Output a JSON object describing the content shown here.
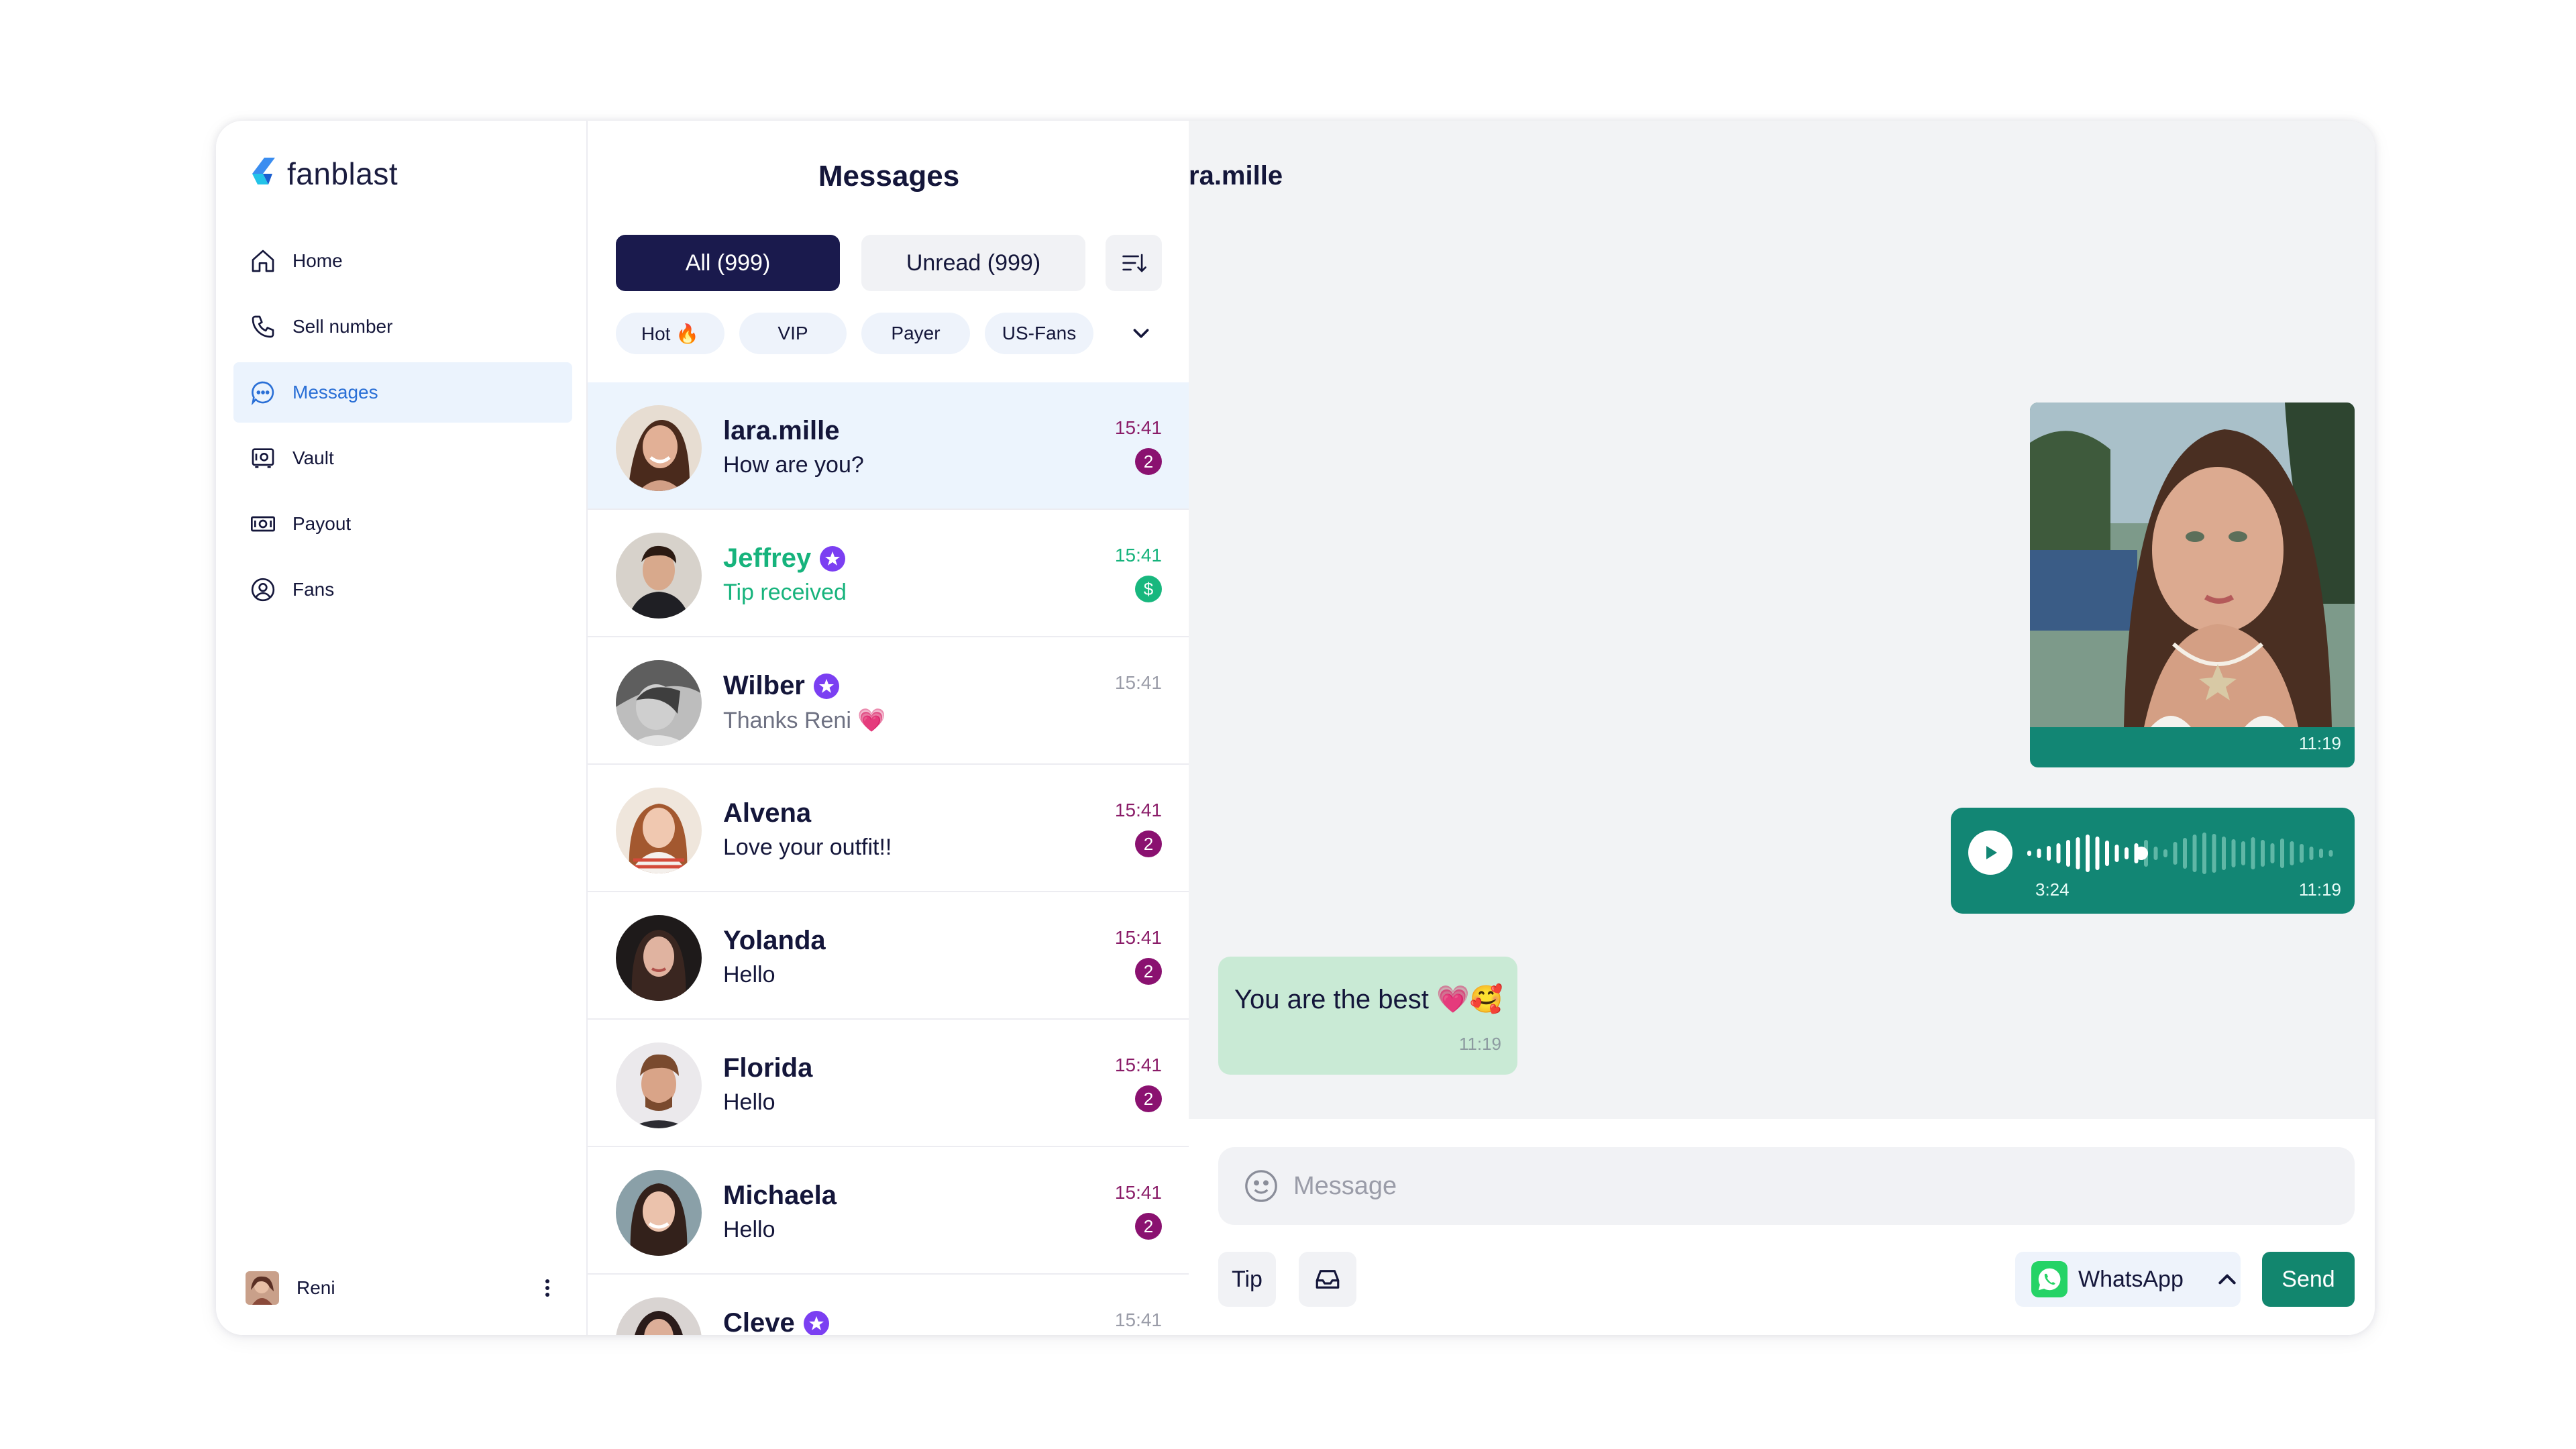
{
  "brand": {
    "name": "fanblast",
    "accent": "#2a6fd6"
  },
  "sidebar": {
    "items": [
      {
        "label": "Home",
        "icon": "home-icon"
      },
      {
        "label": "Sell number",
        "icon": "phone-icon"
      },
      {
        "label": "Messages",
        "icon": "chat-icon",
        "active": true
      },
      {
        "label": "Vault",
        "icon": "vault-icon"
      },
      {
        "label": "Payout",
        "icon": "cash-icon"
      },
      {
        "label": "Fans",
        "icon": "user-circle-icon"
      }
    ],
    "user": {
      "name": "Reni"
    }
  },
  "list": {
    "title": "Messages",
    "filters": {
      "all": "All (999)",
      "unread": "Unread (999)"
    },
    "chips": [
      "Hot 🔥",
      "VIP",
      "Payer",
      "US-Fans"
    ],
    "conversations": [
      {
        "name": "lara.mille",
        "message": "How are you?",
        "time": "15:41",
        "badge": "2"
      },
      {
        "name": "Jeffrey",
        "message": "Tip received",
        "time": "15:41",
        "badge": "$",
        "vip": true
      },
      {
        "name": "Wilber",
        "message": "Thanks Reni 💗",
        "time": "15:41",
        "vip": true
      },
      {
        "name": "Alvena",
        "message": "Love your outfit!!",
        "time": "15:41",
        "badge": "2"
      },
      {
        "name": "Yolanda",
        "message": "Hello",
        "time": "15:41",
        "badge": "2"
      },
      {
        "name": "Florida",
        "message": "Hello",
        "time": "15:41",
        "badge": "2"
      },
      {
        "name": "Michaela",
        "message": "Hello",
        "time": "15:41",
        "badge": "2"
      },
      {
        "name": "Cleve",
        "message": "",
        "time": "15:41",
        "vip": true
      }
    ]
  },
  "chat": {
    "contact": "ra.mille",
    "messages": {
      "photo_time": "11:19",
      "voice_duration": "3:24",
      "voice_time": "11:19",
      "text": "You are the best 💗🥰",
      "text_time": "11:19"
    },
    "composer": {
      "placeholder": "Message",
      "tip_label": "Tip",
      "channel": "WhatsApp",
      "send_label": "Send"
    }
  }
}
